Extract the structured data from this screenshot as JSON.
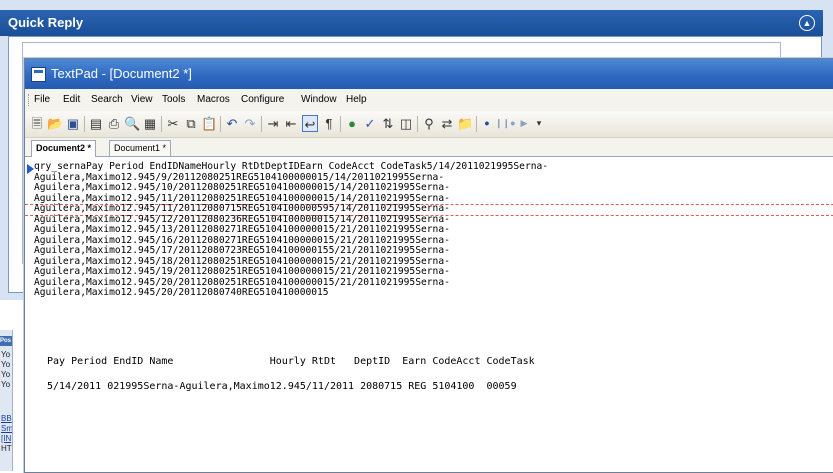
{
  "forum": {
    "quick_reply_title": "Quick Reply",
    "left_panel": {
      "heading": "Pos",
      "lines": [
        "Yo",
        "Yo",
        "Yo",
        "Yo",
        "BB",
        "Sm",
        "[IN",
        "HT"
      ]
    }
  },
  "textpad": {
    "title": "TextPad - [Document2 *]",
    "menu": [
      "File",
      "Edit",
      "Search",
      "View",
      "Tools",
      "Macros",
      "Configure",
      "Window",
      "Help"
    ],
    "toolbar_icons": [
      "new-icon",
      "open-icon",
      "save-icon",
      "save-all-icon",
      "print-icon",
      "print-preview-icon",
      "properties-icon",
      "cut-icon",
      "copy-icon",
      "paste-icon",
      "undo-icon",
      "redo-icon",
      "indent-icon",
      "outdent-icon",
      "word-wrap-icon",
      "paragraph-icon",
      "web-icon",
      "spell-check-icon",
      "sort-icon",
      "compare-icon",
      "find-icon",
      "replace-icon",
      "find-in-files-icon",
      "record-macro-icon",
      "play-macro-icon",
      "playback-icon",
      "toolbar-options-icon"
    ],
    "tabs": [
      {
        "label": "Document2 *",
        "active": true
      },
      {
        "label": "Document1 *",
        "active": false
      }
    ],
    "editor_lines": [
      "qry_sernaPay Period EndIDNameHourly RtDtDeptIDEarn CodeAcct CodeTask5/14/2011021995Serna-",
      "Aguilera,Maximo12.945/9/20112080251REG5104100000015/14/2011021995Serna-",
      "Aguilera,Maximo12.945/10/20112080251REG5104100000015/14/2011021995Serna-",
      "Aguilera,Maximo12.945/11/20112080251REG5104100000015/14/2011021995Serna-",
      "Aguilera,Maximo12.945/11/20112080715REG5104100000595/14/2011021995Serna-",
      "Aguilera,Maximo12.945/12/20112080236REG5104100000015/14/2011021995Serna-",
      "Aguilera,Maximo12.945/13/20112080271REG5104100000015/21/2011021995Serna-",
      "Aguilera,Maximo12.945/16/20112080271REG5104100000015/21/2011021995Serna-",
      "Aguilera,Maximo12.945/17/20112080723REG5104100000155/21/2011021995Serna-",
      "Aguilera,Maximo12.945/18/20112080251REG5104100000015/21/2011021995Serna-",
      "Aguilera,Maximo12.945/19/20112080251REG5104100000015/21/2011021995Serna-",
      "Aguilera,Maximo12.945/20/20112080251REG5104100000015/21/2011021995Serna-",
      "Aguilera,Maximo12.945/20/20112080740REG510410000015"
    ],
    "header_row": "Pay Period EndID Name                Hourly RtDt   DeptID  Earn CodeAcct CodeTask",
    "data_row": "5/14/2011 021995Serna-Aguilera,Maximo12.945/11/2011 2080715 REG 5104100  00059",
    "colors": {
      "title_bar": "#2d68bf",
      "highlight_dash": "#e15a55",
      "forum_header": "#1a4f98"
    }
  }
}
